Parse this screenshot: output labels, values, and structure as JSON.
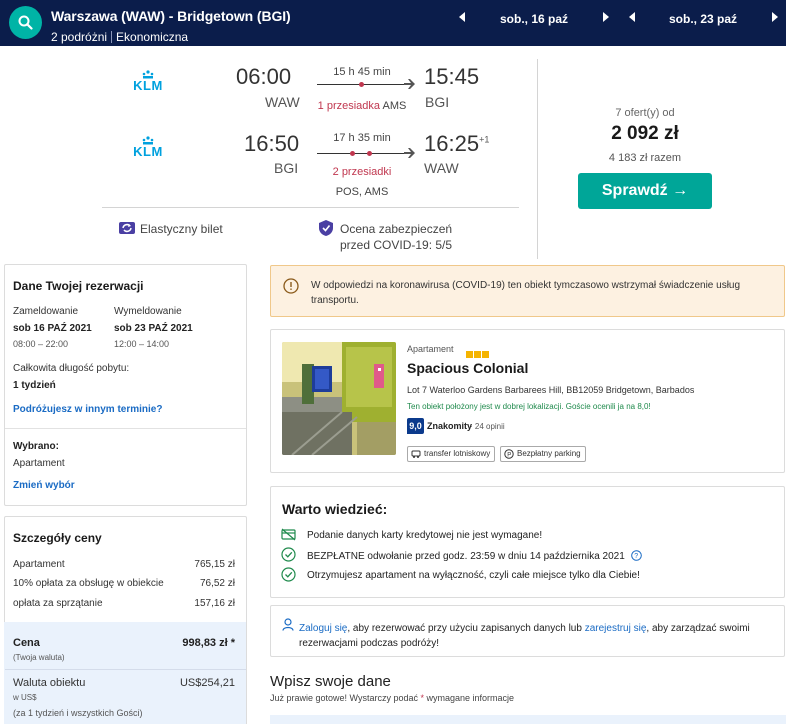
{
  "header": {
    "route": "Warszawa (WAW) - Bridgetown (BGI)",
    "travelers": "2 podróżni",
    "cabin": "Ekonomiczna",
    "depart_date": "sob., 16 paź",
    "return_date": "sob., 23 paź"
  },
  "flights": {
    "outbound": {
      "airline_logo": "KLM",
      "depart_time": "06:00",
      "depart_airport": "WAW",
      "duration": "15 h 45 min",
      "stops": "1 przesiadka",
      "via": "AMS",
      "arrive_time": "15:45",
      "arrive_airport": "BGI"
    },
    "inbound": {
      "airline_logo": "KLM",
      "depart_time": "16:50",
      "depart_airport": "BGI",
      "duration": "17 h 35 min",
      "stops": "2 przesiadki",
      "via": "POS, AMS",
      "arrive_time": "16:25",
      "day_offset": "+1",
      "arrive_airport": "WAW"
    },
    "features": {
      "flexible": "Elastyczny bilet",
      "covid_rating_line1": "Ocena zabezpieczeń",
      "covid_rating_line2": "przed COVID-19: 5/5"
    },
    "offers": "7 ofert(y) od",
    "price": "2 092 zł",
    "total": "4 183 zł razem",
    "check_button": "Sprawdź →"
  },
  "booking": {
    "title": "Dane Twojej rezerwacji",
    "checkin_label": "Zameldowanie",
    "checkin_date": "sob 16 PAŹ 2021",
    "checkin_time": "08:00 – 22:00",
    "checkout_label": "Wymeldowanie",
    "checkout_date": "sob 23 PAŹ 2021",
    "checkout_time": "12:00 – 14:00",
    "stay_label": "Całkowita długość pobytu:",
    "stay_value": "1 tydzień",
    "other_dates_link": "Podróżujesz w innym terminie?",
    "selected_label": "Wybrano:",
    "selected_value": "Apartament",
    "change_link": "Zmień wybór"
  },
  "price_details": {
    "title": "Szczegóły ceny",
    "rows": [
      {
        "label": "Apartament",
        "value": "765,15 zł"
      },
      {
        "label": "10% opłata za obsługę w obiekcie",
        "value": "76,52 zł"
      },
      {
        "label": "opłata za sprzątanie",
        "value": "157,16 zł"
      }
    ],
    "total_label": "Cena",
    "total_sub": "(Twoja waluta)",
    "total_value": "998,83 zł *",
    "local_label": "Waluta obiektu",
    "local_sub": "w US$",
    "local_value": "US$254,21",
    "local_note": "(za 1 tydzień i wszystkich Gości)"
  },
  "covid_notice": {
    "text": "W odpowiedzi na koronawirusa (COVID-19) ten obiekt tymczasowo wstrzymał świadczenie usług transportu."
  },
  "property": {
    "type": "Apartament",
    "star_count": 3,
    "name": "Spacious Colonial",
    "address": "Lot 7 Waterloo Gardens Barbarees Hill, BB12059 Bridgetown, Barbados",
    "location_note": "Ten obiekt położony jest w dobrej lokalizacji. Goście ocenili ja na 8,0!",
    "score": "9,0",
    "score_word": "Znakomity",
    "reviews": "· 24 opinii",
    "tags": [
      "transfer lotniskowy",
      "Bezpłatny parking"
    ]
  },
  "good_to_know": {
    "title": "Warto wiedzieć:",
    "items": [
      "Podanie danych karty kredytowej nie jest wymagane!",
      "BEZPŁATNE odwołanie przed godz. 23:59 w dniu 14 października 2021",
      "Otrzymujesz apartament na wyłączność, czyli całe miejsce tylko dla Ciebie!"
    ]
  },
  "login": {
    "link1": "Zaloguj się",
    "text1": ", aby rezerwować przy użyciu zapisanych danych lub ",
    "link2": "zarejestruj się",
    "text2": ", aby zarządzać swoimi rezerwacjami podczas podróży!"
  },
  "form": {
    "title": "Wpisz swoje dane",
    "subtitle_pre": "Już prawie gotowe! Wystarczy podać ",
    "subtitle_star": "*",
    "subtitle_post": " wymagane informacje"
  },
  "colors": {
    "navy": "#0b1d4b",
    "teal": "#00a698",
    "accent_red": "#c0374f",
    "link_blue": "#1a6bc4",
    "klm_blue": "#00a1de"
  }
}
